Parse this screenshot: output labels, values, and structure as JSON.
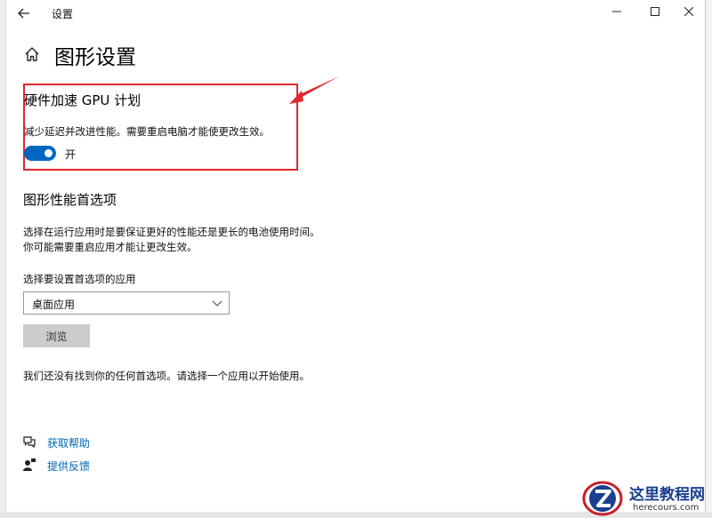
{
  "window": {
    "title": "设置",
    "back_icon": "back-arrow-icon",
    "controls": {
      "minimize": "—",
      "maximize": "☐",
      "close": "✕"
    }
  },
  "page": {
    "title": "图形设置",
    "home_icon": "home-icon"
  },
  "gpu_scheduling": {
    "title": "硬件加速 GPU 计划",
    "description": "减少延迟并改进性能。需要重启电脑才能使更改生效。",
    "toggle_label": "开",
    "toggle_on": true,
    "accent_color": "#0067c0",
    "highlight_color": "#e0272c"
  },
  "graphics_preference": {
    "title": "图形性能首选项",
    "description_line1": "选择在运行应用时是要保证更好的性能还是更长的电池使用时间。",
    "description_line2": "你可能需要重启应用才能让更改生效。",
    "select_label": "选择要设置首选项的应用",
    "select_value": "桌面应用",
    "browse_button": "浏览",
    "empty_message": "我们还没有找到你的任何首选项。请选择一个应用以开始使用。"
  },
  "links": {
    "get_help": "获取帮助",
    "feedback": "提供反馈"
  },
  "watermark": {
    "site_name": "这里教程网",
    "url": "herecours.com"
  }
}
